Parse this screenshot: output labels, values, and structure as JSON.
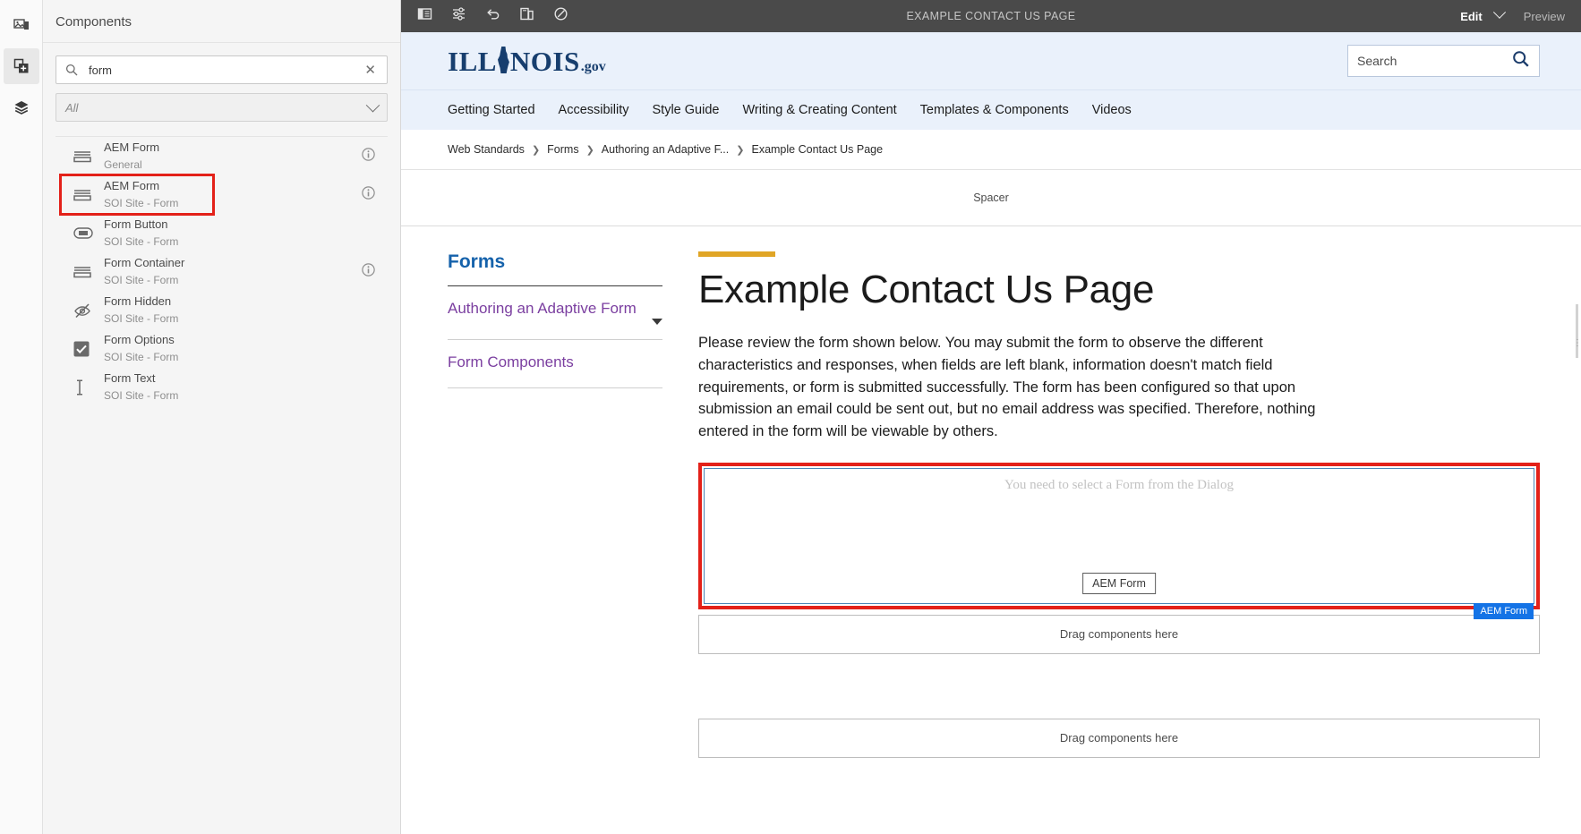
{
  "rail": {
    "items": [
      {
        "name": "assets-icon",
        "label": "Assets"
      },
      {
        "name": "components-icon",
        "label": "Components"
      },
      {
        "name": "layers-icon",
        "label": "Content Tree"
      }
    ]
  },
  "panel": {
    "title": "Components",
    "search": {
      "value": "form",
      "placeholder": "Search",
      "clear": "✕"
    },
    "filter": {
      "value": "All"
    },
    "components": [
      {
        "title": "AEM Form",
        "group": "General",
        "icon": "form-lines-icon",
        "info": true,
        "selected": false
      },
      {
        "title": "AEM Form",
        "group": "SOI Site - Form",
        "icon": "form-lines-icon",
        "info": true,
        "selected": true
      },
      {
        "title": "Form Button",
        "group": "SOI Site - Form",
        "icon": "button-icon",
        "info": false,
        "selected": false
      },
      {
        "title": "Form Container",
        "group": "SOI Site - Form",
        "icon": "form-lines-icon",
        "info": true,
        "selected": false
      },
      {
        "title": "Form Hidden",
        "group": "SOI Site - Form",
        "icon": "eye-off-icon",
        "info": false,
        "selected": false
      },
      {
        "title": "Form Options",
        "group": "SOI Site - Form",
        "icon": "checkbox-icon",
        "info": false,
        "selected": false
      },
      {
        "title": "Form Text",
        "group": "SOI Site - Form",
        "icon": "text-cursor-icon",
        "info": false,
        "selected": false
      }
    ]
  },
  "toolbar": {
    "title": "EXAMPLE CONTACT US PAGE",
    "edit_label": "Edit",
    "preview_label": "Preview",
    "icons": [
      "side-panel-icon",
      "page-properties-icon",
      "undo-icon",
      "emulator-icon",
      "preview-mode-icon"
    ]
  },
  "site": {
    "logo": {
      "part1": "ILL",
      "part2": "NOIS",
      "suffix": ".gov"
    },
    "search": {
      "placeholder": "Search"
    },
    "nav": [
      "Getting Started",
      "Accessibility",
      "Style Guide",
      "Writing & Creating Content",
      "Templates & Components",
      "Videos"
    ],
    "breadcrumb": [
      "Web Standards",
      "Forms",
      "Authoring an Adaptive F...",
      "Example Contact Us Page"
    ],
    "spacer_label": "Spacer"
  },
  "sidebar": {
    "heading": "Forms",
    "links": [
      "Authoring an Adaptive Form",
      "Form Components"
    ]
  },
  "article": {
    "title": "Example Contact Us Page",
    "body": "Please review the form shown below. You may submit the form to observe the different characteristics and responses, when fields are left blank, information doesn't match field requirements, or form is submitted successfully. The form has been configured so that upon submission an email could be sent out, but no email address was specified. Therefore, nothing entered in the form will be viewable by others."
  },
  "form_placeholder": {
    "message": "You need to select a Form from the Dialog",
    "tooltip": "AEM Form",
    "badge": "AEM Form"
  },
  "dropzones": [
    "Drag components here",
    "Drag components here"
  ],
  "colors": {
    "toolbar_bg": "#4a4a4a",
    "selection_red": "#e32119",
    "badge_blue": "#1473e6",
    "link_blue": "#1562ab",
    "link_purple": "#7b3fa0",
    "accent_gold": "#e0a526",
    "logo_navy": "#173e6e",
    "site_band": "#eaf1fb"
  }
}
